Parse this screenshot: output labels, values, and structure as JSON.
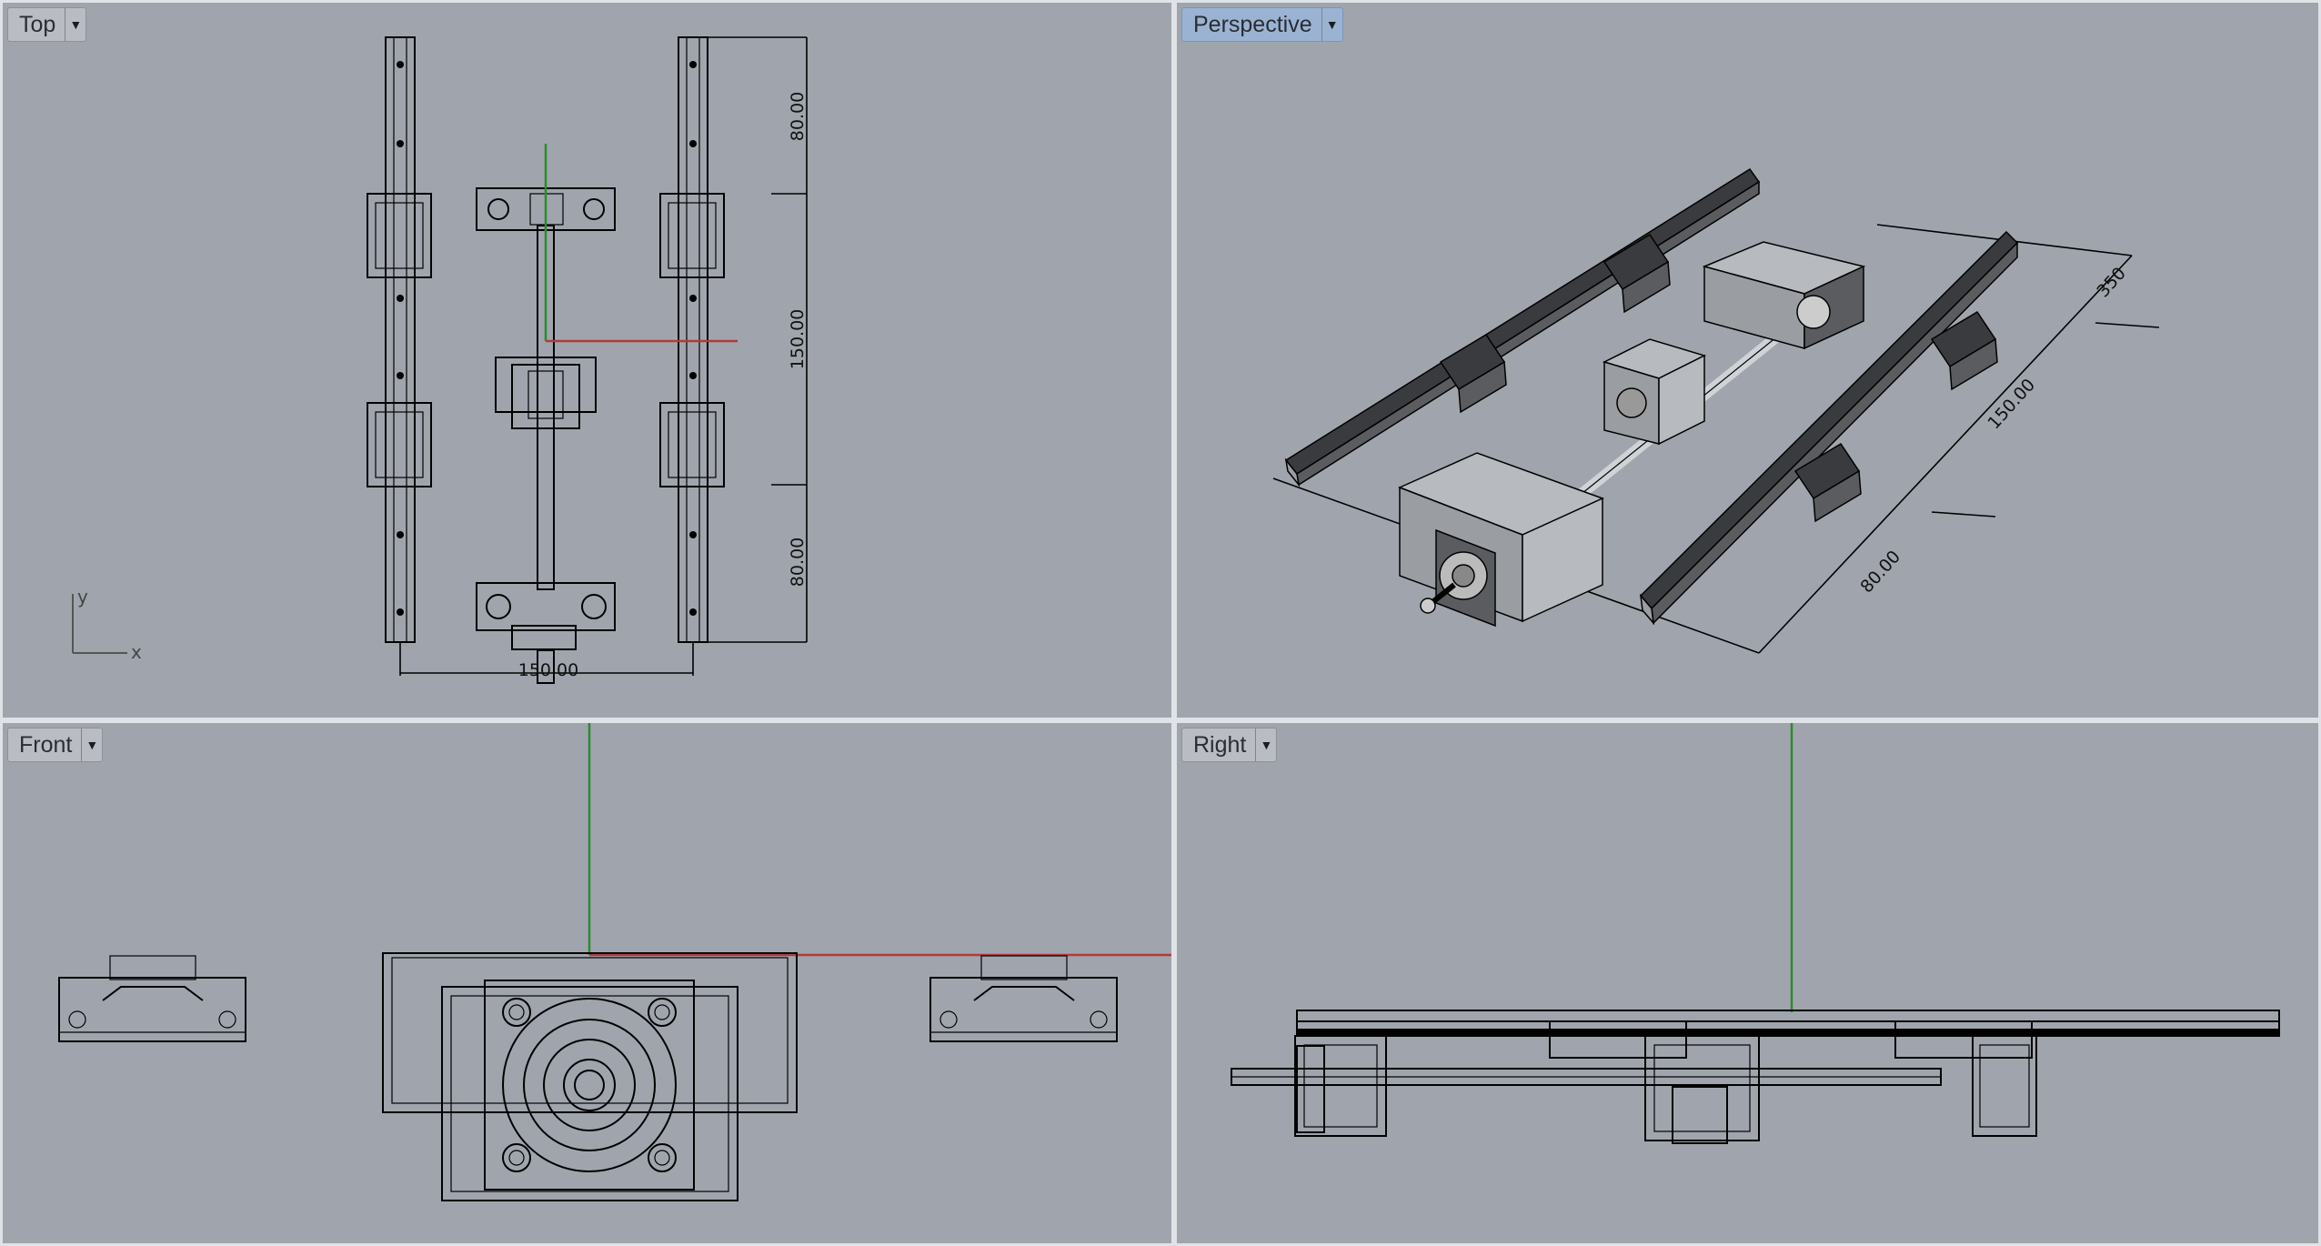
{
  "viewports": {
    "top": {
      "title": "Top",
      "active": false
    },
    "perspective": {
      "title": "Perspective",
      "active": true
    },
    "front": {
      "title": "Front",
      "active": false
    },
    "right": {
      "title": "Right",
      "active": false
    }
  },
  "dropdown_icon": "caret-down",
  "top_view": {
    "dimensions": [
      "80.00",
      "150.00",
      "80.00",
      "150.00"
    ],
    "axis_labels": {
      "y": "y",
      "x": "x"
    }
  },
  "perspective_view": {
    "dimensions": [
      "350",
      "150.00",
      "80.00"
    ]
  },
  "colors": {
    "viewport_bg": "#a0a5ad",
    "active_title_bg": "#9bb3d3",
    "axis_y": "#2c8c2c",
    "axis_x": "#b23a3a"
  }
}
